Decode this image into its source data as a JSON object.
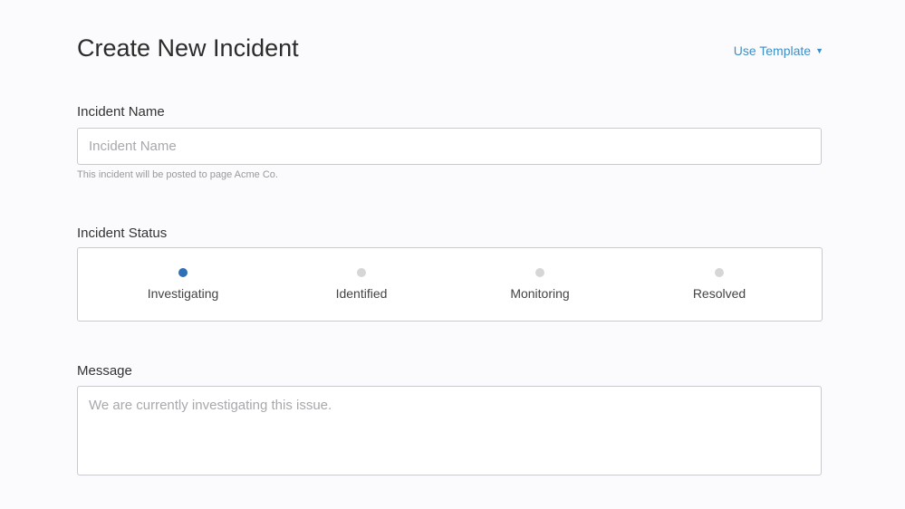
{
  "page": {
    "title": "Create New Incident",
    "use_template": "Use Template"
  },
  "name": {
    "label": "Incident Name",
    "placeholder": "Incident Name",
    "help": "This incident will be posted to page Acme Co."
  },
  "status": {
    "label": "Incident Status",
    "options": [
      {
        "label": "Investigating",
        "selected": true
      },
      {
        "label": "Identified"
      },
      {
        "label": "Monitoring"
      },
      {
        "label": "Resolved"
      }
    ]
  },
  "message": {
    "label": "Message",
    "placeholder": "We are currently investigating this issue."
  },
  "colors": {
    "accent": "#3d8fc6",
    "selected_dot": "#2f6fb5"
  }
}
